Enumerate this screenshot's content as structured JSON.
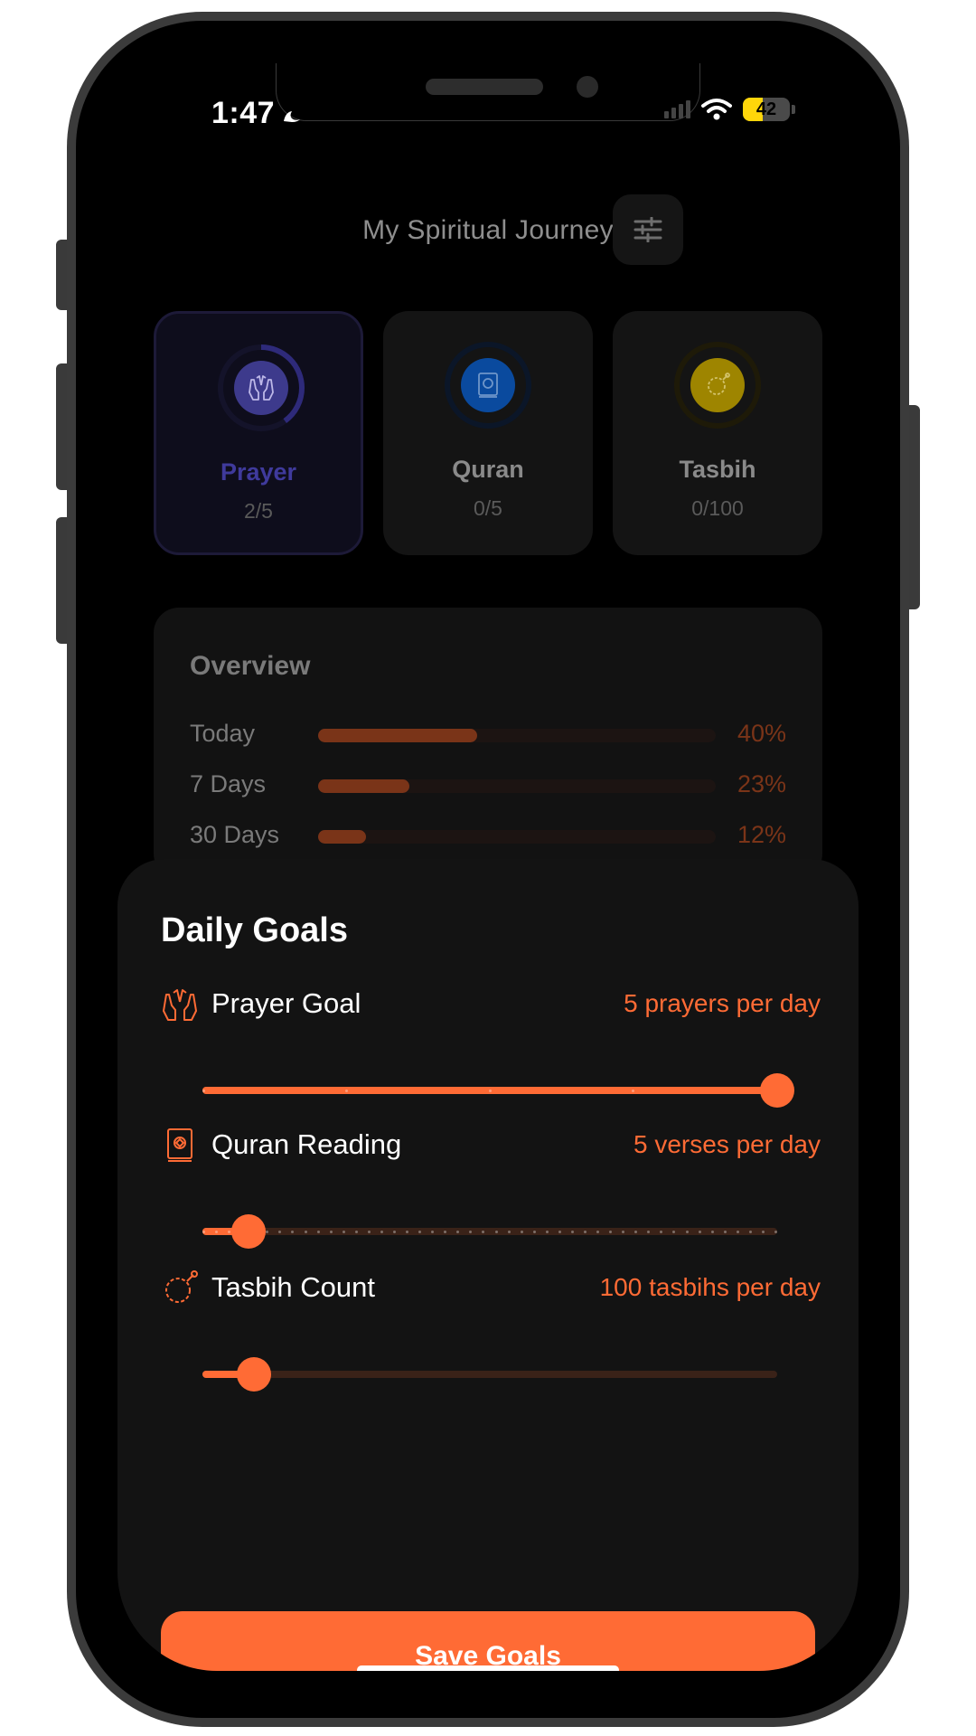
{
  "status_bar": {
    "time": "1:47",
    "battery": "42",
    "battery_level": 0.42
  },
  "header": {
    "title": "My Spiritual Journey",
    "filter_icon": "sliders-icon"
  },
  "cards": [
    {
      "label": "Prayer",
      "count": "2/5",
      "progress": 0.4,
      "icon": "praying-hands-icon",
      "color": "#3d3a8c",
      "active": true
    },
    {
      "label": "Quran",
      "count": "0/5",
      "progress": 0,
      "icon": "quran-book-icon",
      "color": "#0a4a9e",
      "active": false
    },
    {
      "label": "Tasbih",
      "count": "0/100",
      "progress": 0,
      "icon": "tasbih-beads-icon",
      "color": "#9e8500",
      "active": false
    }
  ],
  "overview": {
    "title": "Overview",
    "rows": [
      {
        "label": "Today",
        "pct": "40%",
        "value": 0.4
      },
      {
        "label": "7 Days",
        "pct": "23%",
        "value": 0.23
      },
      {
        "label": "30 Days",
        "pct": "12%",
        "value": 0.12
      }
    ]
  },
  "sheet": {
    "title": "Daily Goals",
    "goals": [
      {
        "label": "Prayer Goal",
        "value_text": "5 prayers per day",
        "icon": "praying-hands-icon",
        "fraction": 1.0
      },
      {
        "label": "Quran Reading",
        "value_text": "5 verses per day",
        "icon": "quran-book-icon",
        "fraction": 0.08
      },
      {
        "label": "Tasbih Count",
        "value_text": "100 tasbihs per day",
        "icon": "tasbih-beads-icon",
        "fraction": 0.09
      }
    ],
    "save_label": "Save Goals"
  },
  "colors": {
    "accent": "#ff6b35",
    "background": "#000000",
    "sheet": "#131313"
  }
}
